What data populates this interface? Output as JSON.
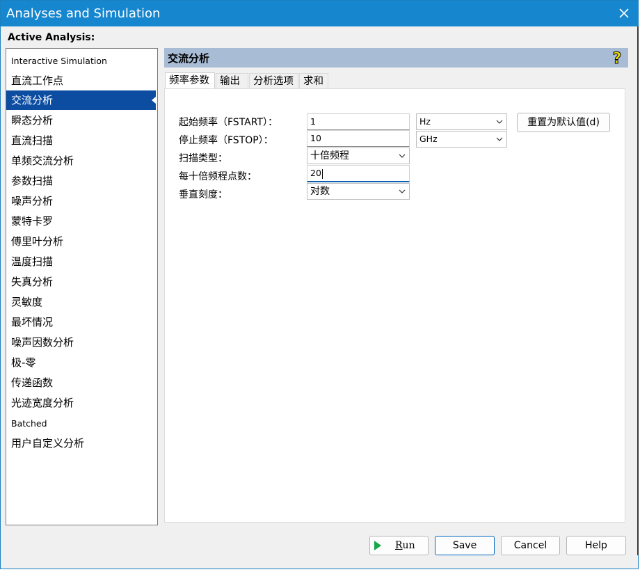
{
  "window": {
    "title": "Analyses and Simulation"
  },
  "section": {
    "active_analysis_label": "Active Analysis:"
  },
  "analyses": [
    {
      "label": "Interactive Simulation",
      "small": true,
      "selected": false
    },
    {
      "label": "直流工作点",
      "small": false,
      "selected": false
    },
    {
      "label": "交流分析",
      "small": false,
      "selected": true
    },
    {
      "label": "瞬态分析",
      "small": false,
      "selected": false
    },
    {
      "label": "直流扫描",
      "small": false,
      "selected": false
    },
    {
      "label": "单频交流分析",
      "small": false,
      "selected": false
    },
    {
      "label": "参数扫描",
      "small": false,
      "selected": false
    },
    {
      "label": "噪声分析",
      "small": false,
      "selected": false
    },
    {
      "label": "蒙特卡罗",
      "small": false,
      "selected": false
    },
    {
      "label": "傅里叶分析",
      "small": false,
      "selected": false
    },
    {
      "label": "温度扫描",
      "small": false,
      "selected": false
    },
    {
      "label": "失真分析",
      "small": false,
      "selected": false
    },
    {
      "label": "灵敏度",
      "small": false,
      "selected": false
    },
    {
      "label": "最坏情况",
      "small": false,
      "selected": false
    },
    {
      "label": "噪声因数分析",
      "small": false,
      "selected": false
    },
    {
      "label": "极-零",
      "small": false,
      "selected": false
    },
    {
      "label": "传递函数",
      "small": false,
      "selected": false
    },
    {
      "label": "光迹宽度分析",
      "small": false,
      "selected": false
    },
    {
      "label": "Batched",
      "small": true,
      "selected": false
    },
    {
      "label": "用户自定义分析",
      "small": false,
      "selected": false
    }
  ],
  "panel": {
    "title": "交流分析",
    "help_icon": "help-question-icon",
    "tabs": [
      "频率参数",
      "输出",
      "分析选项",
      "求和"
    ],
    "active_tab": 0
  },
  "form": {
    "fstart_label": "起始频率（FSTART）：",
    "fstart_value": "1",
    "fstart_unit": "Hz",
    "fstop_label": "停止频率（FSTOP）：",
    "fstop_value": "10",
    "fstop_unit": "GHz",
    "sweep_type_label": "扫描类型：",
    "sweep_type_value": "十倍频程",
    "points_label": "每十倍频程点数：",
    "points_value": "20",
    "vscale_label": "垂直刻度：",
    "vscale_value": "对数",
    "reset_button": "重置为默认值(d)"
  },
  "buttons": {
    "run_first": "R",
    "run_rest": "un",
    "save": "Save",
    "cancel": "Cancel",
    "help": "Help"
  },
  "colors": {
    "titlebar": "#1686cf",
    "selected_item": "#0c4da2",
    "panel_header": "#a9bcd6",
    "run_icon": "#17a84a"
  }
}
